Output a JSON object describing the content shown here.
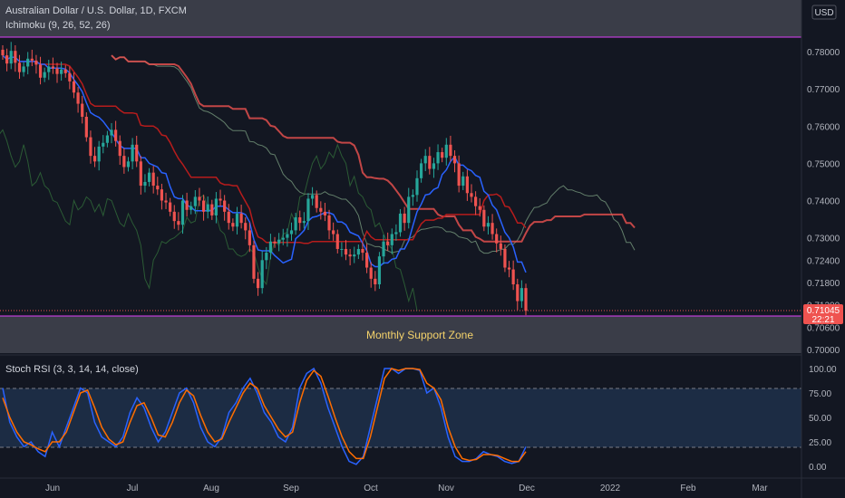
{
  "header": {
    "symbol_title": "Australian Dollar / U.S. Dollar, 1D, FXCM",
    "indicator_label": "Ichimoku (9, 26, 52, 26)",
    "currency_button": "USD"
  },
  "price_badge": {
    "price": "0.71045",
    "countdown": "22:21"
  },
  "zone_label": "Monthly Support Zone",
  "oscillator_label": "Stoch RSI (3, 3, 14, 14, close)",
  "colors": {
    "background": "#131722",
    "up_candle": "#26a69a",
    "down_candle": "#ef5350",
    "zone_line": "#e040fb",
    "zone_fill": "#3a3d48",
    "stoch_k": "#2962ff",
    "stoch_d": "#ff6d00",
    "tenkan": "#2962ff",
    "kijun": "#b71c1c",
    "cloud_top": "#a5d6a7",
    "cloud_bottom": "#ef5350",
    "label_yellow": "#f5d36b"
  },
  "chart_data": [
    {
      "type": "candlestick",
      "title": "Australian Dollar / U.S. Dollar, 1D, FXCM",
      "y_ticks": [
        "0.78000",
        "0.77000",
        "0.76000",
        "0.75000",
        "0.74000",
        "0.73000",
        "0.72400",
        "0.71800",
        "0.71200",
        "0.70600",
        "0.70000"
      ],
      "x_ticks": [
        "Jun",
        "Jul",
        "Aug",
        "Sep",
        "Oct",
        "Nov",
        "Dec",
        "2022",
        "Feb",
        "Mar"
      ],
      "support_zone": {
        "label": "Monthly Support Zone",
        "from": 0.6993,
        "to": 0.7096
      },
      "resistance_line": 0.7838,
      "last_price": 0.71045,
      "series": [
        {
          "name": "Close",
          "values": [
            0.779,
            0.7768,
            0.7802,
            0.777,
            0.7745,
            0.776,
            0.7781,
            0.7776,
            0.7765,
            0.773,
            0.7745,
            0.776,
            0.7755,
            0.774,
            0.7752,
            0.7742,
            0.772,
            0.769,
            0.766,
            0.7625,
            0.757,
            0.752,
            0.7505,
            0.7545,
            0.7555,
            0.7575,
            0.759,
            0.756,
            0.752,
            0.749,
            0.7505,
            0.755,
            0.7505,
            0.744,
            0.745,
            0.7475,
            0.744,
            0.743,
            0.74,
            0.7395,
            0.737,
            0.7345,
            0.7335,
            0.74,
            0.7375,
            0.7385,
            0.741,
            0.74,
            0.737,
            0.739,
            0.736,
            0.7405,
            0.74,
            0.737,
            0.734,
            0.733,
            0.7365,
            0.734,
            0.732,
            0.728,
            0.719,
            0.7165,
            0.724,
            0.726,
            0.729,
            0.7285,
            0.7295,
            0.73,
            0.731,
            0.732,
            0.7355,
            0.734,
            0.7345,
            0.7405,
            0.7415,
            0.738,
            0.737,
            0.736,
            0.732,
            0.731,
            0.727,
            0.727,
            0.7255,
            0.725,
            0.7255,
            0.727,
            0.726,
            0.722,
            0.719,
            0.7175,
            0.725,
            0.729,
            0.728,
            0.731,
            0.7315,
            0.7365,
            0.734,
            0.741,
            0.7415,
            0.746,
            0.75,
            0.752,
            0.7485,
            0.75,
            0.753,
            0.7515,
            0.755,
            0.752,
            0.75,
            0.744,
            0.7465,
            0.742,
            0.741,
            0.7385,
            0.7375,
            0.733,
            0.734,
            0.731,
            0.7285,
            0.727,
            0.722,
            0.7215,
            0.7175,
            0.713,
            0.7165,
            0.7104
          ]
        },
        {
          "name": "Ichimoku",
          "values": []
        }
      ]
    },
    {
      "type": "line",
      "title": "Stoch RSI (3, 3, 14, 14, close)",
      "y_ticks": [
        "100.00",
        "75.00",
        "50.00",
        "25.00",
        "0.00"
      ],
      "bands": {
        "upper": 80,
        "lower": 20
      },
      "x": [
        "Jun",
        "Jul",
        "Aug",
        "Sep",
        "Oct",
        "Nov",
        "Dec"
      ],
      "series": [
        {
          "name": "K",
          "values": [
            80,
            45,
            30,
            20,
            25,
            15,
            10,
            35,
            20,
            40,
            60,
            80,
            75,
            45,
            30,
            25,
            20,
            30,
            55,
            70,
            60,
            40,
            25,
            35,
            55,
            75,
            80,
            65,
            40,
            25,
            20,
            30,
            55,
            65,
            80,
            90,
            75,
            55,
            45,
            30,
            25,
            40,
            80,
            95,
            100,
            85,
            60,
            40,
            20,
            5,
            2,
            10,
            40,
            70,
            100,
            100,
            95,
            100,
            100,
            98,
            75,
            80,
            60,
            30,
            10,
            5,
            5,
            8,
            15,
            12,
            10,
            5,
            3,
            5,
            20
          ]
        },
        {
          "name": "D",
          "values": [
            70,
            50,
            35,
            25,
            22,
            18,
            15,
            25,
            25,
            35,
            55,
            75,
            78,
            60,
            40,
            28,
            22,
            25,
            45,
            62,
            65,
            50,
            32,
            30,
            45,
            65,
            78,
            72,
            52,
            35,
            25,
            28,
            45,
            60,
            75,
            85,
            80,
            62,
            50,
            38,
            30,
            35,
            65,
            88,
            98,
            92,
            72,
            50,
            30,
            15,
            8,
            8,
            30,
            60,
            90,
            100,
            98,
            100,
            100,
            99,
            85,
            80,
            68,
            40,
            20,
            8,
            6,
            7,
            12,
            12,
            11,
            8,
            5,
            5,
            15
          ]
        }
      ]
    }
  ]
}
